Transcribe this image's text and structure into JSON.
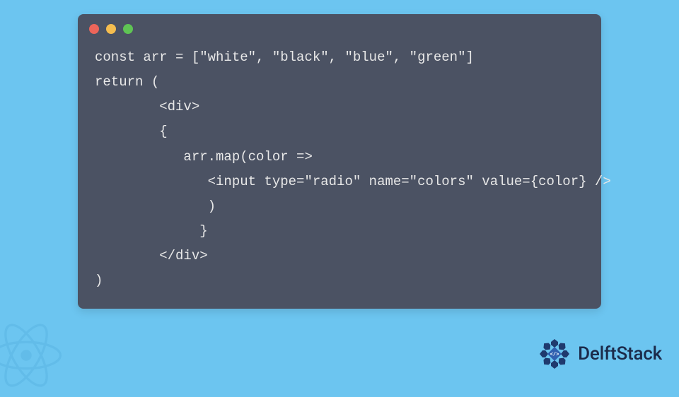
{
  "window": {
    "dots": {
      "red": "#ec655a",
      "yellow": "#f5bd4f",
      "green": "#5fc454"
    }
  },
  "code": {
    "line1": "const arr = [\"white\", \"black\", \"blue\", \"green\"]",
    "line2": "return (",
    "line3": "        <div>",
    "line4": "        {",
    "line5": "           arr.map(color =>",
    "line6": "              <input type=\"radio\" name=\"colors\" value={color} />",
    "line7": "              )",
    "line8": "             }",
    "line9": "        </div>",
    "line10": ")"
  },
  "brand": {
    "name": "DelftStack"
  }
}
